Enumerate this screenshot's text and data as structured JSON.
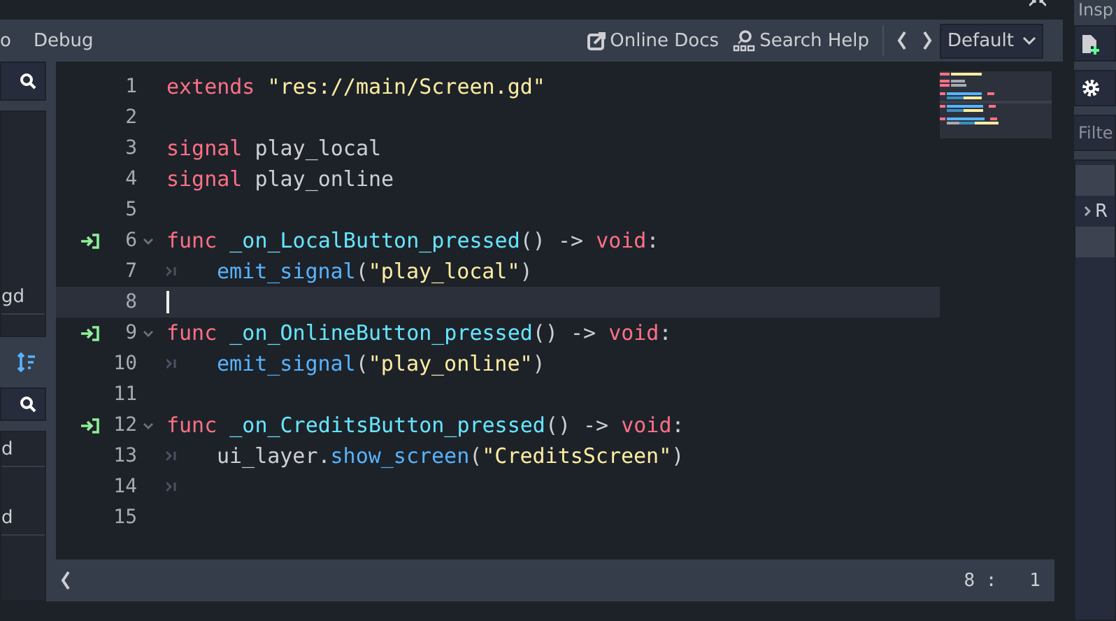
{
  "menu": [
    {
      "label": "o"
    },
    {
      "label": "Debug"
    }
  ],
  "toolbar": {
    "online_docs": "Online Docs",
    "search_help": "Search Help",
    "theme": "Default"
  },
  "left_panel": {
    "scripts": [
      {
        "label": "gd"
      }
    ],
    "methods": [
      {
        "label": "d"
      },
      {
        "label": "d"
      }
    ]
  },
  "editor": {
    "lines": [
      {
        "number": "1",
        "connected": false,
        "foldable": false,
        "current": false,
        "indented": false,
        "tokens": [
          {
            "kind": "keyword",
            "text": "extends"
          },
          {
            "kind": "string",
            "text": " \"res://main/Screen.gd\""
          }
        ]
      },
      {
        "number": "2",
        "connected": false,
        "foldable": false,
        "current": false,
        "indented": false
      },
      {
        "number": "3",
        "connected": false,
        "foldable": false,
        "current": false,
        "indented": false,
        "tokens": [
          {
            "kind": "keyword",
            "text": "signal"
          },
          {
            "kind": "plain",
            "text": " play_local"
          }
        ]
      },
      {
        "number": "4",
        "connected": false,
        "foldable": false,
        "current": false,
        "indented": false,
        "tokens": [
          {
            "kind": "keyword",
            "text": "signal"
          },
          {
            "kind": "plain",
            "text": " play_online"
          }
        ]
      },
      {
        "number": "5",
        "connected": false,
        "foldable": false,
        "current": false,
        "indented": false
      },
      {
        "number": "6",
        "connected": true,
        "foldable": true,
        "current": false,
        "indented": false,
        "tokens": [
          {
            "kind": "keyword",
            "text": "func"
          },
          {
            "kind": "function",
            "text": " _on_LocalButton_pressed"
          },
          {
            "kind": "plain",
            "text": "() -> "
          },
          {
            "kind": "keyword",
            "text": "void"
          },
          {
            "kind": "plain",
            "text": ":"
          }
        ]
      },
      {
        "number": "7",
        "connected": false,
        "foldable": false,
        "current": false,
        "indented": true,
        "tokens": [
          {
            "kind": "call",
            "text": "emit_signal"
          },
          {
            "kind": "plain",
            "text": "("
          },
          {
            "kind": "string",
            "text": "\"play_local\""
          },
          {
            "kind": "plain",
            "text": ")"
          }
        ]
      },
      {
        "number": "8",
        "connected": false,
        "foldable": false,
        "current": true,
        "indented": false
      },
      {
        "number": "9",
        "connected": true,
        "foldable": true,
        "current": false,
        "indented": false,
        "tokens": [
          {
            "kind": "keyword",
            "text": "func"
          },
          {
            "kind": "function",
            "text": " _on_OnlineButton_pressed"
          },
          {
            "kind": "plain",
            "text": "() -> "
          },
          {
            "kind": "keyword",
            "text": "void"
          },
          {
            "kind": "plain",
            "text": ":"
          }
        ]
      },
      {
        "number": "10",
        "connected": false,
        "foldable": false,
        "current": false,
        "indented": true,
        "tokens": [
          {
            "kind": "call",
            "text": "emit_signal"
          },
          {
            "kind": "plain",
            "text": "("
          },
          {
            "kind": "string",
            "text": "\"play_online\""
          },
          {
            "kind": "plain",
            "text": ")"
          }
        ]
      },
      {
        "number": "11",
        "connected": false,
        "foldable": false,
        "current": false,
        "indented": false
      },
      {
        "number": "12",
        "connected": true,
        "foldable": true,
        "current": false,
        "indented": false,
        "tokens": [
          {
            "kind": "keyword",
            "text": "func"
          },
          {
            "kind": "function",
            "text": " _on_CreditsButton_pressed"
          },
          {
            "kind": "plain",
            "text": "() -> "
          },
          {
            "kind": "keyword",
            "text": "void"
          },
          {
            "kind": "plain",
            "text": ":"
          }
        ]
      },
      {
        "number": "13",
        "connected": false,
        "foldable": false,
        "current": false,
        "indented": true,
        "tokens": [
          {
            "kind": "plain",
            "text": "ui_layer."
          },
          {
            "kind": "call",
            "text": "show_screen"
          },
          {
            "kind": "plain",
            "text": "("
          },
          {
            "kind": "string",
            "text": "\"CreditsScreen\""
          },
          {
            "kind": "plain",
            "text": ")"
          }
        ]
      },
      {
        "number": "14",
        "connected": false,
        "foldable": false,
        "current": false,
        "indented": true
      },
      {
        "number": "15",
        "connected": false,
        "foldable": false,
        "current": false,
        "indented": false
      }
    ]
  },
  "status": {
    "position": "8 :   1"
  },
  "inspector": {
    "title": "Insp",
    "filter_placeholder": "Filte",
    "rows": [
      {
        "selected": true
      },
      {
        "label": "R",
        "selected": false
      },
      {
        "selected": true
      }
    ]
  }
}
